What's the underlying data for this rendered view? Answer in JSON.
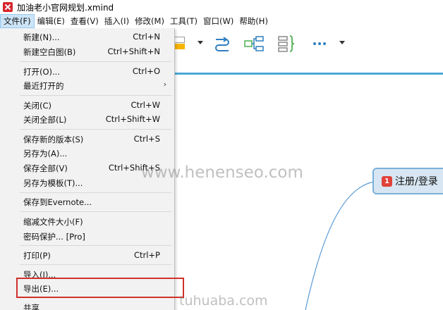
{
  "window": {
    "title": "加油老小官网规划.xmind"
  },
  "menubar": {
    "items": [
      {
        "label": "文件(F)",
        "active": true
      },
      {
        "label": "编辑(E)"
      },
      {
        "label": "查看(V)"
      },
      {
        "label": "插入(I)"
      },
      {
        "label": "修改(M)"
      },
      {
        "label": "工具(T)"
      },
      {
        "label": "窗口(W)"
      },
      {
        "label": "帮助(H)"
      }
    ]
  },
  "file_menu": {
    "items": [
      {
        "label": "新建(N)...",
        "shortcut": "Ctrl+N"
      },
      {
        "label": "新建空白图(B)",
        "shortcut": "Ctrl+Shift+N"
      },
      {
        "label": "打开(O)...",
        "shortcut": "Ctrl+O"
      },
      {
        "label": "最近打开的",
        "submenu": "›"
      },
      {
        "label": "关闭(C)",
        "shortcut": "Ctrl+W"
      },
      {
        "label": "关闭全部(L)",
        "shortcut": "Ctrl+Shift+W"
      },
      {
        "label": "保存新的版本(S)",
        "shortcut": "Ctrl+S"
      },
      {
        "label": "另存为(A)..."
      },
      {
        "label": "保存全部(V)",
        "shortcut": "Ctrl+Shift+S"
      },
      {
        "label": "另存为模板(T)..."
      },
      {
        "label": "保存到Evernote..."
      },
      {
        "label": "缩减文件大小(F)"
      },
      {
        "label": "密码保护... [Pro]"
      },
      {
        "label": "打印(P)",
        "shortcut": "Ctrl+P"
      },
      {
        "label": "导入(I)..."
      },
      {
        "label": "导出(E)...",
        "highlighted": true
      },
      {
        "label": "共享"
      }
    ]
  },
  "canvas": {
    "node": {
      "badge": "1",
      "text": "注册/登录"
    },
    "watermarks": [
      "www.henenseo.com",
      "tuhuaba.com"
    ]
  },
  "colors": {
    "accent_blue": "#4aa8d8",
    "node_fill": "#d7e6f2",
    "node_border": "#7ab0d8",
    "badge_red": "#e0433a",
    "highlight_red": "#d0302b",
    "icon_blue": "#2f7fc1",
    "icon_green": "#4caf50",
    "icon_yellow": "#f6b300"
  },
  "toolbar_icons": [
    "style-icon",
    "dropdown-icon",
    "relationship-icon",
    "structure-icon",
    "summary-icon",
    "more-icon",
    "dropdown-icon"
  ]
}
